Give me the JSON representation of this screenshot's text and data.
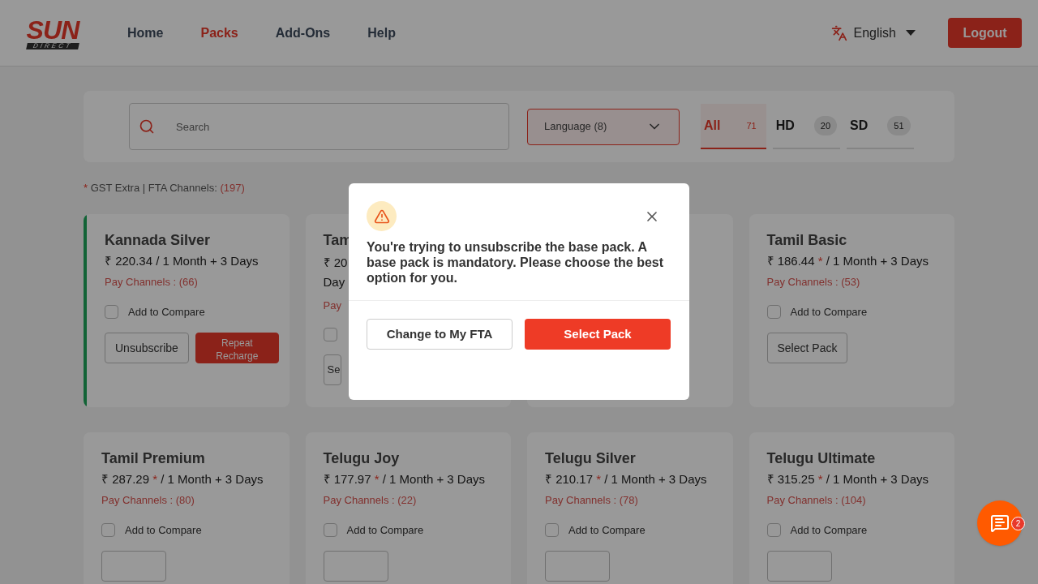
{
  "logo": {
    "main": "SUN",
    "sub": "DIRECT"
  },
  "nav": [
    {
      "label": "Home",
      "selected": false
    },
    {
      "label": "Packs",
      "selected": true
    },
    {
      "label": "Add-Ons",
      "selected": false
    },
    {
      "label": "Help",
      "selected": false
    }
  ],
  "language_menu": {
    "label": "English"
  },
  "logout": "Logout",
  "search": {
    "placeholder": "Search"
  },
  "language_filter": "Language (8)",
  "tabs": [
    {
      "label": "All",
      "count": "71",
      "selected": true
    },
    {
      "label": "HD",
      "count": "20",
      "selected": false
    },
    {
      "label": "SD",
      "count": "51",
      "selected": false
    }
  ],
  "note": {
    "mark": "*",
    "text": "GST Extra | FTA Channels:",
    "count": "(197)"
  },
  "cards": [
    {
      "kind": "full",
      "subscribed": true,
      "title": "Kannada Silver",
      "price": "₹ 220.34",
      "period": "/ 1 Month + 3 Days",
      "pay_channels": "Pay Channels : (66)",
      "compare": {
        "label": "Add to Compare",
        "checked": false
      },
      "buttons": [
        {
          "kind": "outline",
          "label": "Unsubscribe"
        },
        {
          "kind": "solid",
          "label": "Repeat Recharge"
        }
      ]
    },
    {
      "kind": "covered",
      "subscribed": false,
      "title": "Tam",
      "price": "₹ 20",
      "period": "Day",
      "pay_channels": "Pay",
      "compare": {
        "checked": false
      },
      "buttons": [
        {
          "kind": "outline",
          "label": "Se"
        }
      ]
    },
    {
      "kind": "hidden"
    },
    {
      "kind": "full",
      "subscribed": false,
      "title": "Tamil Basic",
      "price": "₹ 186.44",
      "gst_mark": "*",
      "period": "/ 1 Month + 3 Days",
      "pay_channels": "Pay Channels : (53)",
      "compare": {
        "label": "Add to Compare",
        "checked": false
      },
      "buttons": [
        {
          "kind": "outline",
          "label": "Select Pack"
        }
      ]
    },
    {
      "kind": "full",
      "subscribed": false,
      "title": "Tamil Premium",
      "price": "₹ 287.29",
      "gst_mark": "*",
      "period": "/ 1 Month + 3 Days",
      "pay_channels": "Pay Channels : (80)",
      "compare": {
        "label": "Add to Compare",
        "checked": false
      },
      "buttons": [
        {
          "kind": "outline"
        }
      ]
    },
    {
      "kind": "full",
      "subscribed": false,
      "title": "Telugu Joy",
      "price": "₹ 177.97",
      "gst_mark": "*",
      "period": "/ 1 Month + 3 Days",
      "pay_channels": "Pay Channels : (22)",
      "compare": {
        "label": "Add to Compare",
        "checked": false
      },
      "buttons": [
        {
          "kind": "outline"
        }
      ]
    },
    {
      "kind": "full",
      "subscribed": false,
      "title": "Telugu Silver",
      "price": "₹ 210.17",
      "gst_mark": "*",
      "period": "/ 1 Month + 3 Days",
      "pay_channels": "Pay Channels : (78)",
      "compare": {
        "label": "Add to Compare",
        "checked": false
      },
      "buttons": [
        {
          "kind": "outline"
        }
      ]
    },
    {
      "kind": "full",
      "subscribed": false,
      "title": "Telugu Ultimate",
      "price": "₹ 315.25",
      "gst_mark": "*",
      "period": "/ 1 Month + 3 Days",
      "pay_channels": "Pay Channels : (104)",
      "compare": {
        "label": "Add to Compare",
        "checked": false
      },
      "buttons": [
        {
          "kind": "outline"
        }
      ]
    }
  ],
  "dialog": {
    "message": "You're trying to unsubscribe the base pack. A base pack is mandatory. Please choose the best option for you.",
    "buttons": [
      {
        "kind": "outline",
        "label": "Change to My FTA"
      },
      {
        "kind": "solid",
        "label": "Select Pack"
      }
    ]
  },
  "chat": {
    "badge": "2"
  }
}
